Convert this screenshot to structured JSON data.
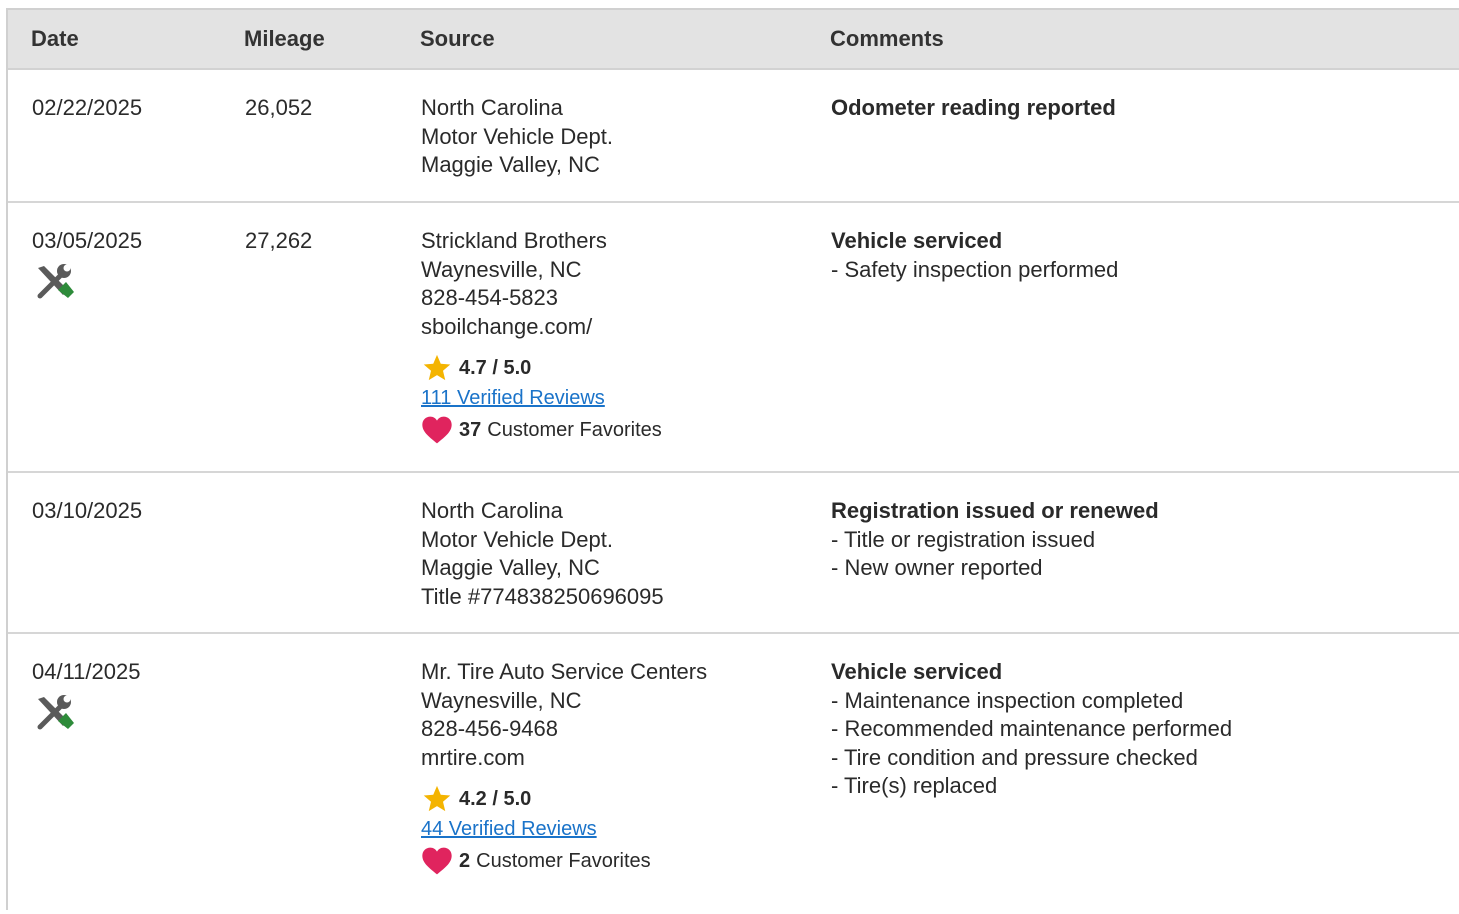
{
  "columns": {
    "date": "Date",
    "mileage": "Mileage",
    "source": "Source",
    "comments": "Comments"
  },
  "records": [
    {
      "date": "02/22/2025",
      "mileage": "26,052",
      "source": [
        "North Carolina",
        "Motor Vehicle Dept.",
        "Maggie Valley, NC"
      ],
      "comment_title": "Odometer reading reported",
      "comments": []
    },
    {
      "date": "03/05/2025",
      "mileage": "27,262",
      "service_icon": "wrench-screwdriver-icon",
      "source": [
        "Strickland Brothers",
        "Waynesville, NC",
        "828-454-5823",
        "sboilchange.com/"
      ],
      "rating": "4.7 / 5.0",
      "reviews": "111 Verified Reviews",
      "favorites_count": "37",
      "favorites_label": "Customer Favorites",
      "comment_title": "Vehicle serviced",
      "comments": [
        "- Safety inspection performed"
      ]
    },
    {
      "date": "03/10/2025",
      "mileage": "",
      "source": [
        "North Carolina",
        "Motor Vehicle Dept.",
        "Maggie Valley, NC",
        "Title #774838250696095"
      ],
      "comment_title": "Registration issued or renewed",
      "comments": [
        "- Title or registration issued",
        "- New owner reported"
      ]
    },
    {
      "date": "04/11/2025",
      "mileage": "",
      "service_icon": "wrench-screwdriver-icon",
      "source": [
        "Mr. Tire Auto Service Centers",
        "Waynesville, NC",
        "828-456-9468",
        "mrtire.com"
      ],
      "rating": "4.2 / 5.0",
      "reviews": "44 Verified Reviews",
      "favorites_count": "2",
      "favorites_label": "Customer Favorites",
      "comment_title": "Vehicle serviced",
      "comments": [
        "- Maintenance inspection completed",
        "- Recommended maintenance performed",
        "- Tire condition and pressure checked",
        "- Tire(s) replaced"
      ]
    }
  ],
  "colors": {
    "star": "#f4b400",
    "heart": "#e0245e",
    "link": "#1a73c9",
    "tool_handle": "#2e8b3a",
    "tool_metal": "#555555"
  }
}
